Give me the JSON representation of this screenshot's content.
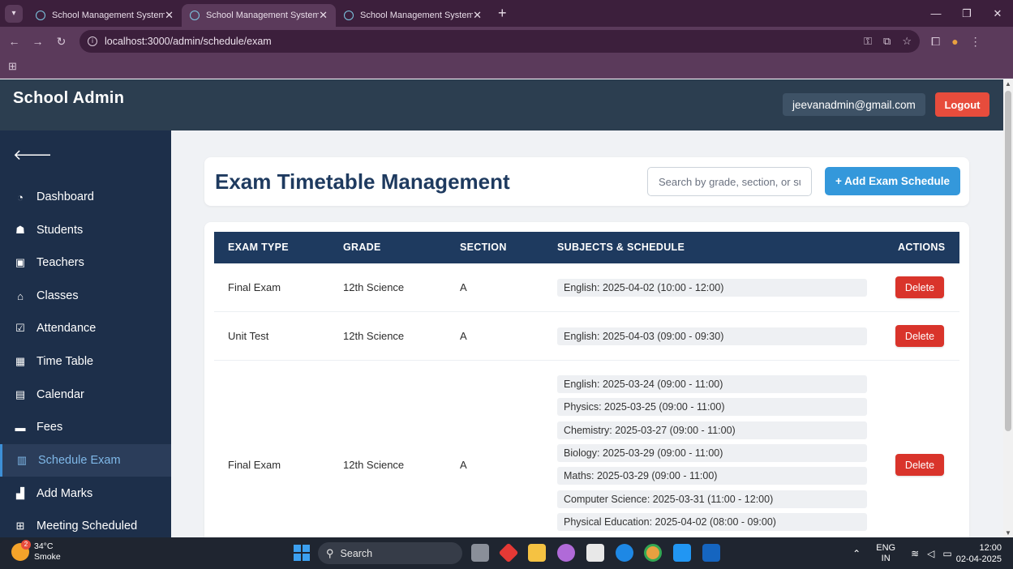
{
  "browser": {
    "tabs": [
      {
        "title": "School Management System",
        "active": false
      },
      {
        "title": "School Management System",
        "active": true
      },
      {
        "title": "School Management System",
        "active": false
      }
    ],
    "url": "localhost:3000/admin/schedule/exam"
  },
  "header": {
    "brand": "School Admin",
    "email": "jeevanadmin@gmail.com",
    "logout_label": "Logout"
  },
  "sidebar": {
    "items": [
      {
        "label": "Dashboard",
        "icon": "gauge-icon"
      },
      {
        "label": "Students",
        "icon": "student-icon"
      },
      {
        "label": "Teachers",
        "icon": "teacher-icon"
      },
      {
        "label": "Classes",
        "icon": "school-icon"
      },
      {
        "label": "Attendance",
        "icon": "calendar-check-icon"
      },
      {
        "label": "Time Table",
        "icon": "calendar-grid-icon"
      },
      {
        "label": "Calendar",
        "icon": "calendar-icon"
      },
      {
        "label": "Fees",
        "icon": "wallet-icon"
      },
      {
        "label": "Schedule Exam",
        "icon": "clipboard-icon",
        "active": true
      },
      {
        "label": "Add Marks",
        "icon": "chart-icon"
      },
      {
        "label": "Meeting Scheduled",
        "icon": "calendar-plus-icon"
      }
    ]
  },
  "main": {
    "title": "Exam Timetable Management",
    "search_placeholder": "Search by grade, section, or subject",
    "add_label": "+ Add Exam Schedule",
    "columns": [
      "EXAM TYPE",
      "GRADE",
      "SECTION",
      "SUBJECTS & SCHEDULE",
      "ACTIONS"
    ],
    "delete_label": "Delete",
    "rows": [
      {
        "exam_type": "Final Exam",
        "grade": "12th Science",
        "section": "A",
        "schedule": [
          "English: 2025-04-02 (10:00 - 12:00)"
        ]
      },
      {
        "exam_type": "Unit Test",
        "grade": "12th Science",
        "section": "A",
        "schedule": [
          "English: 2025-04-03 (09:00 - 09:30)"
        ]
      },
      {
        "exam_type": "Final Exam",
        "grade": "12th Science",
        "section": "A",
        "schedule": [
          "English: 2025-03-24 (09:00 - 11:00)",
          "Physics: 2025-03-25 (09:00 - 11:00)",
          "Chemistry: 2025-03-27 (09:00 - 11:00)",
          "Biology: 2025-03-29 (09:00 - 11:00)",
          "Maths: 2025-03-29 (09:00 - 11:00)",
          "Computer Science: 2025-03-31 (11:00 - 12:00)",
          "Physical Education: 2025-04-02 (08:00 - 09:00)"
        ]
      }
    ]
  },
  "taskbar": {
    "weather_temp": "34°C",
    "weather_desc": "Smoke",
    "weather_badge": "2",
    "search_label": "Search",
    "lang_top": "ENG",
    "lang_bottom": "IN",
    "time": "12:00",
    "date": "02-04-2025"
  }
}
